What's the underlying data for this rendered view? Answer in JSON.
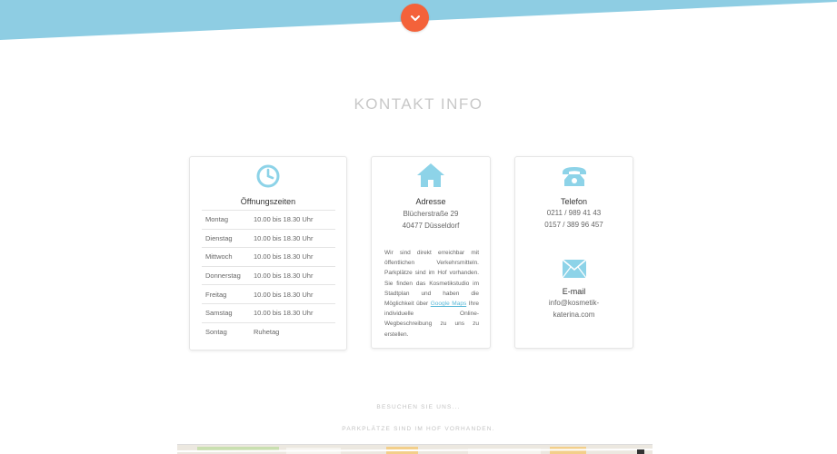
{
  "section": {
    "title": "KONTAKT INFO"
  },
  "colors": {
    "accent": "#f4623a",
    "band": "#8ecde3",
    "icon": "#8dd3e8"
  },
  "hours": {
    "icon": "clock-icon",
    "title": "Öffnungszeiten",
    "rows": [
      {
        "day": "Montag",
        "time": "10.00 bis 18.30 Uhr"
      },
      {
        "day": "Dienstag",
        "time": "10.00 bis 18.30 Uhr"
      },
      {
        "day": "Mittwoch",
        "time": "10.00 bis 18.30 Uhr"
      },
      {
        "day": "Donnerstag",
        "time": "10.00 bis 18.30 Uhr"
      },
      {
        "day": "Freitag",
        "time": "10.00 bis 18.30 Uhr"
      },
      {
        "day": "Samstag",
        "time": "10.00 bis 18.30 Uhr"
      },
      {
        "day": "Sontag",
        "time": "Ruhetag"
      }
    ]
  },
  "address": {
    "icon": "home-icon",
    "title": "Adresse",
    "street": "Blücherstraße 29",
    "city": "40477 Düsseldorf",
    "desc_before": "Wir sind direkt erreichbar mit öffentlichen Verkehrsmitteln. Parkplätze sind im Hof vorhanden. Sie finden das Kosmetikstudio im Stadtplan und haben die Möglichkeit über ",
    "desc_link": "Google Maps",
    "desc_after": " Ihre individuelle Online-Wegbeschreibung zu uns zu erstellen."
  },
  "phone": {
    "icon": "phone-icon",
    "title": "Telefon",
    "number1": "0211 / 989 41 43",
    "number2": "0157 / 389 96 457"
  },
  "email": {
    "icon": "envelope-icon",
    "title": "E-mail",
    "line1": "info@kosmetik-",
    "line2": "katerina.com"
  },
  "visit": {
    "label": "BESUCHEN SIE UNS..."
  },
  "parking": {
    "label": "PARKPLÄTZE SIND IM HOF VORHANDEN."
  }
}
